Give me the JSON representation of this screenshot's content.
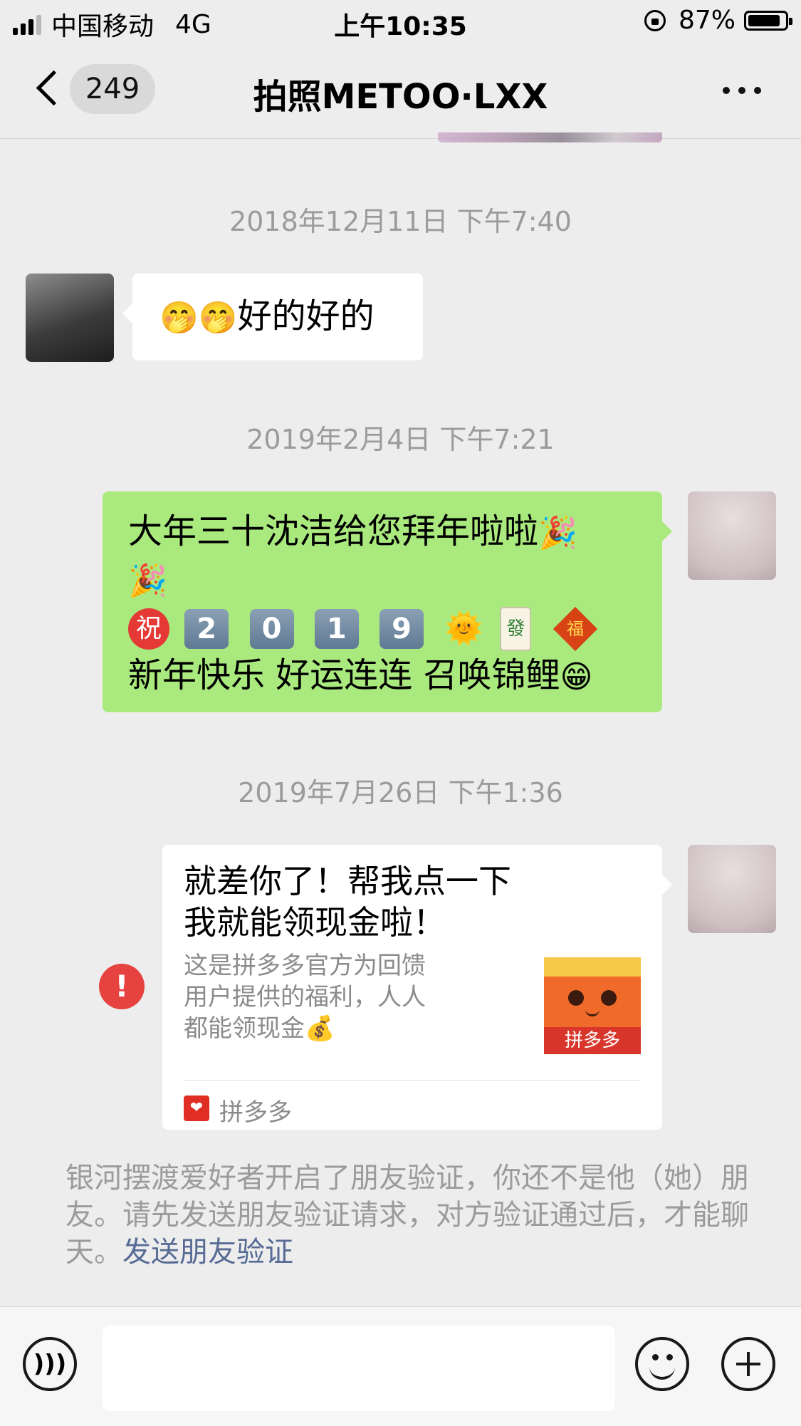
{
  "status_bar": {
    "carrier": "中国移动",
    "network": "4G",
    "time": "上午10:35",
    "battery_percent": "87%",
    "battery_level": 0.87,
    "signal_bars": 3
  },
  "nav": {
    "unread_count": "249",
    "title": "拍照METOO·LXX"
  },
  "messages": [
    {
      "timestamp": "2018年12月11日 下午7:40",
      "sender": "other",
      "emoji": "🤭🤭",
      "text": "好的好的"
    },
    {
      "timestamp": "2019年2月4日 下午7:21",
      "sender": "self",
      "line1": "大年三十沈洁给您拜年啦啦",
      "party_emoji": "🎉",
      "zhu": "祝",
      "year_digits": [
        "2",
        "0",
        "1",
        "9"
      ],
      "sun_emoji": "🌞",
      "mahjong": "發",
      "fu": "福",
      "line3": "新年快乐 好运连连 召唤锦鲤",
      "grin_emoji": "😁"
    },
    {
      "timestamp": "2019年7月26日 下午1:36",
      "sender": "self",
      "card_title": "就差你了！帮我点一下我就能领现金啦！",
      "card_desc": "这是拼多多官方为回馈用户提供的福利，人人都能领现金",
      "card_desc_emoji": "💰",
      "thumb_brand": "拼多多",
      "source": "拼多多",
      "failed_icon": "!"
    }
  ],
  "system_notice": {
    "text": "银河摆渡爱好者开启了朋友验证，你还不是他（她）朋友。请先发送朋友验证请求，对方验证通过后，才能聊天。",
    "link": "发送朋友验证"
  },
  "input_bar": {
    "voice_icon": "voice-icon",
    "emoji_icon": "emoji-icon",
    "plus_icon": "plus-icon",
    "input_value": ""
  },
  "colors": {
    "background": "#ededed",
    "self_bubble": "#a9e97d",
    "other_bubble": "#ffffff",
    "link": "#576b95",
    "error": "#e64340"
  }
}
